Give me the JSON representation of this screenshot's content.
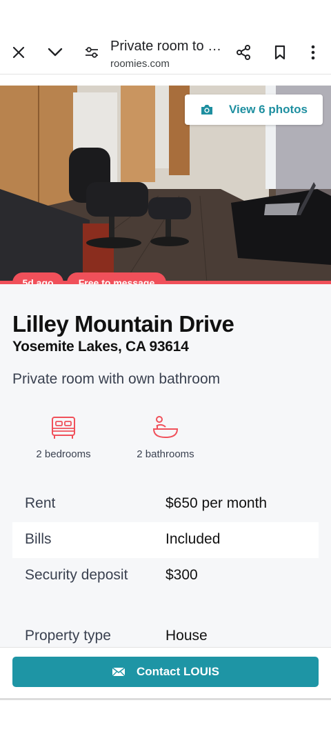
{
  "browser": {
    "title": "Private room to …",
    "url": "roomies.com",
    "icons": [
      "close-icon",
      "chevron-down-icon",
      "tune-icon",
      "share-icon",
      "bookmark-icon",
      "more-vert-icon"
    ]
  },
  "hero": {
    "view_photos_label": "View 6 photos",
    "camera_icon": "camera-icon"
  },
  "badges": {
    "age": "5d ago",
    "message": "Free to message"
  },
  "listing": {
    "title": "Lilley Mountain Drive",
    "location": "Yosemite Lakes, CA 93614",
    "description": "Private room with own bathroom",
    "features": [
      {
        "icon": "bed-icon",
        "label": "2 bedrooms"
      },
      {
        "icon": "bath-icon",
        "label": "2 bathrooms"
      }
    ],
    "details": [
      {
        "key": "Rent",
        "value": "$650 per month"
      },
      {
        "key": "Bills",
        "value": "Included"
      },
      {
        "key": "Security deposit",
        "value": "$300"
      },
      {
        "key": "Property type",
        "value": "House"
      }
    ]
  },
  "cta": {
    "label": "Contact LOUIS",
    "icon": "mail-icon"
  },
  "colors": {
    "accent": "#f0505a",
    "teal": "#1e95a5"
  }
}
